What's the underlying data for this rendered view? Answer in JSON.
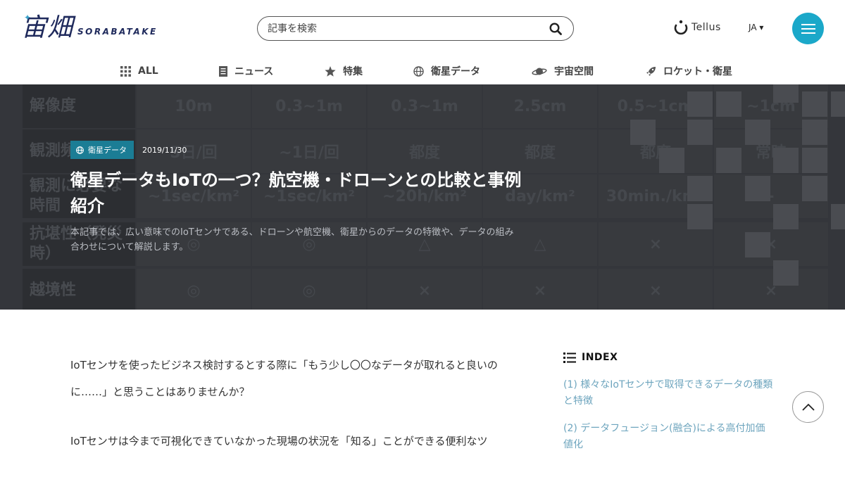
{
  "brand": {
    "logo_mark": "宙畑",
    "logo_text": "SORABATAKE"
  },
  "search": {
    "placeholder": "記事を検索"
  },
  "partner": {
    "name": "Tellus"
  },
  "language": {
    "current": "JA ▾"
  },
  "nav": {
    "items": [
      {
        "label": "ALL",
        "icon": "grid-icon"
      },
      {
        "label": "ニュース",
        "icon": "document-icon"
      },
      {
        "label": "特集",
        "icon": "star-icon"
      },
      {
        "label": "衛星データ",
        "icon": "globe-icon"
      },
      {
        "label": "宇宙空間",
        "icon": "planet-icon"
      },
      {
        "label": "ロケット・衛星",
        "icon": "rocket-icon"
      }
    ]
  },
  "hero": {
    "category": "衛星データ",
    "date": "2019/11/30",
    "title": "衛星データもIoTの一つ？航空機・ドローンとの比較と事例紹介",
    "description": "本記事では、広い意味でのIoTセンサである、ドローンや航空機、衛星からのデータの特徴や、データの組み合わせについて解説します。",
    "background_table": {
      "rows": [
        {
          "head": "解像度",
          "cells": [
            "10m",
            "0.3~1m",
            "0.3~1m",
            "2.5cm",
            "0.5~1cm",
            "~1cm"
          ]
        },
        {
          "head": "観測頻度",
          "cells": [
            "5日/回",
            "~1日/回",
            "都度",
            "都度",
            "都度",
            "常時"
          ]
        },
        {
          "head": "観測に必要な時間",
          "cells": [
            "~1sec/km²",
            "~1sec/km²",
            "~20h/km²",
            "day/km²",
            "30min./km²",
            "-"
          ]
        },
        {
          "head": "抗堪性（発災時）",
          "cells": [
            "◎",
            "◎",
            "△",
            "△",
            "×",
            "×"
          ]
        },
        {
          "head": "越境性",
          "cells": [
            "◎",
            "◎",
            "×",
            "×",
            "×",
            "×"
          ]
        }
      ]
    }
  },
  "article": {
    "paragraphs": [
      "IoTセンサを使ったビジネス検討するとする際に「もう少し〇〇なデータが取れると良いのに……」と思うことはありませんか？",
      "IoTセンサは今まで可視化できていなかった現場の状況を「知る」ことができる便利なツ"
    ]
  },
  "toc": {
    "heading": "INDEX",
    "items": [
      "(1) 様々なIoTセンサで取得できるデータの種類と特徴",
      "(2) データフュージョン(融合)による高付加価値化"
    ]
  },
  "colors": {
    "accent": "#1ba8c9",
    "badge": "#1b7d95",
    "brand": "#1f2a5c",
    "toc_link": "#6ea5be"
  }
}
